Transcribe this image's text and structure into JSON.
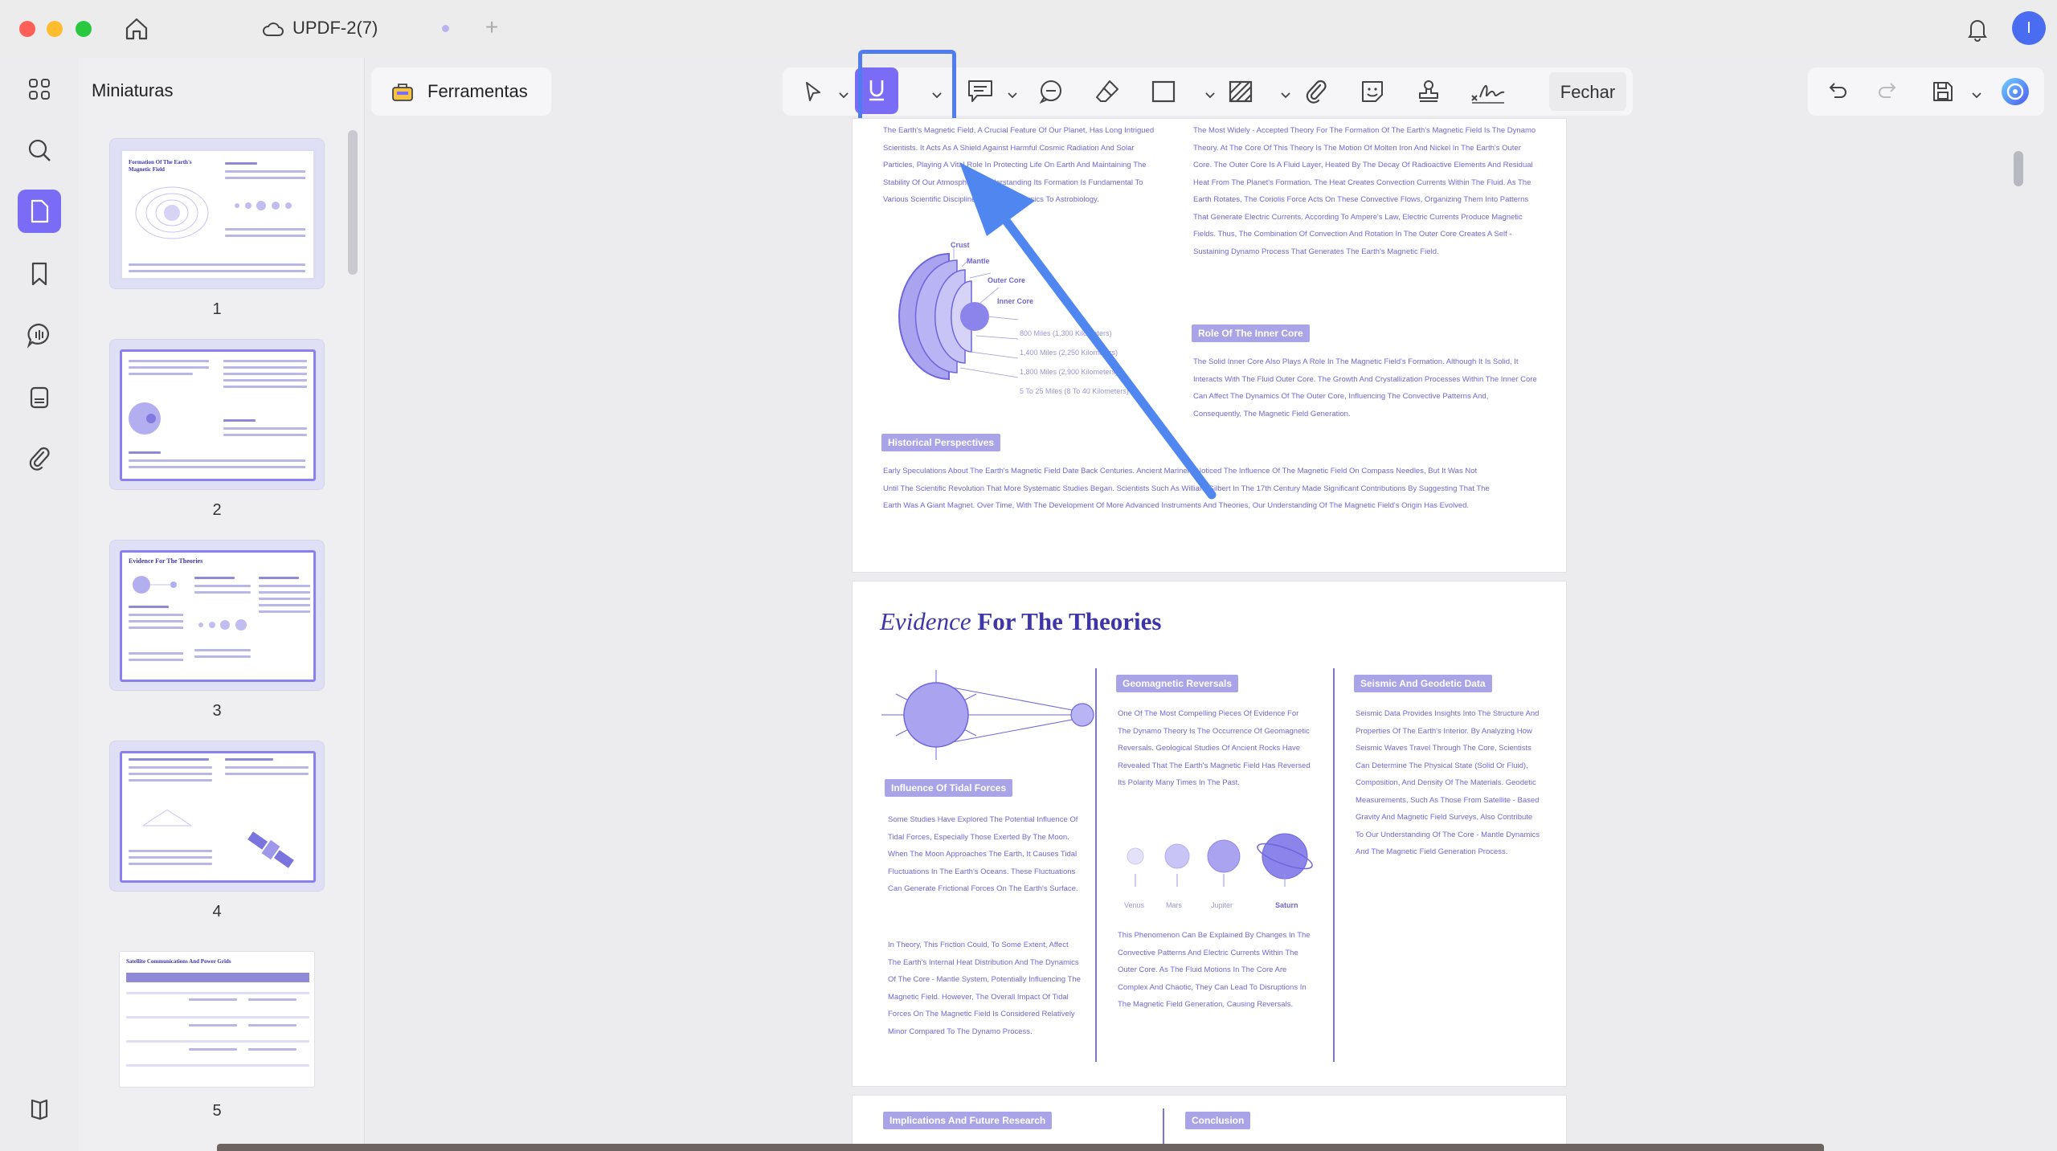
{
  "window": {
    "tab_title": "UPDF-2(7)",
    "avatar_initial": "I"
  },
  "sidebar": {
    "title": "Miniaturas",
    "pages": [
      "1",
      "2",
      "3",
      "4",
      "5"
    ],
    "thumb_titles": {
      "p1": "Formation Of The Earth's Magnetic Field",
      "p3": "Evidence For The Theories",
      "p5": "Satellite Communications And Power Grids"
    }
  },
  "toolbar": {
    "tools_label": "Ferramentas",
    "close_label": "Fechar"
  },
  "page2": {
    "intro": "The Earth's Magnetic Field, A Crucial Feature Of Our Planet, Has Long Intrigued Scientists. It Acts As A Shield Against Harmful Cosmic Radiation And Solar Particles, Playing A Vital Role In Protecting Life On Earth And Maintaining The Stability Of Our Atmosphere. Understanding Its Formation Is Fundamental To Various Scientific Disciplines, From Geophysics To Astrobiology.",
    "diagram_labels": {
      "crust": "Crust",
      "mantle": "Mantle",
      "outer_core": "Outer Core",
      "inner_core": "Inner Core",
      "d1": "800 Miles (1,300 Kilometers)",
      "d2": "1,400 Miles (2,250 Kilometers)",
      "d3": "1,800 Miles (2,900 Kilometers)",
      "d4": "5 To 25 Miles (8 To 40 Kilometers)"
    },
    "dynamo_text": "The Most Widely - Accepted Theory For The Formation Of The Earth's Magnetic Field Is The Dynamo Theory. At The Core Of This Theory Is The Motion Of Molten Iron And Nickel In The Earth's Outer Core. The Outer Core Is A Fluid Layer, Heated By The Decay Of Radioactive Elements And Residual Heat From The Planet's Formation. The Heat Creates Convection Currents Within The Fluid. As The Earth Rotates, The Coriolis Force Acts On These Convective Flows, Organizing Them Into Patterns That Generate Electric Currents. According To Ampere's Law, Electric Currents Produce Magnetic Fields. Thus, The Combination Of Convection And Rotation In The Outer Core Creates A Self - Sustaining Dynamo Process That Generates The Earth's Magnetic Field.",
    "inner_core_heading": "Role Of The Inner Core",
    "inner_core_text": "The Solid Inner Core Also Plays A Role In The Magnetic Field's Formation. Although It Is Solid, It Interacts With The Fluid Outer Core. The Growth And Crystallization Processes Within The Inner Core Can Affect The Dynamics Of The Outer Core, Influencing The Convective Patterns And, Consequently, The Magnetic Field Generation.",
    "historical_heading": "Historical Perspectives",
    "historical_text": "Early Speculations About The Earth's Magnetic Field Date Back Centuries. Ancient Mariners Noticed The Influence Of The Magnetic Field On Compass Needles, But It Was Not Until The Scientific Revolution That More Systematic Studies Began. Scientists Such As William Gilbert In The 17th Century Made Significant Contributions By Suggesting That The Earth Was A Giant Magnet. Over Time, With The Development Of More Advanced Instruments And Theories, Our Understanding Of The Magnetic Field's Origin Has Evolved."
  },
  "page3": {
    "title_italic": "Evidence",
    "title_rest": " For The Theories",
    "tidal_heading": "Influence Of Tidal Forces",
    "tidal_text_1": "Some Studies Have Explored The Potential Influence Of Tidal Forces, Especially Those Exerted By The Moon. When The Moon Approaches The Earth, It Causes Tidal Fluctuations In The Earth's Oceans. These Fluctuations Can Generate Frictional Forces On The Earth's Surface.",
    "tidal_text_2": "In Theory, This Friction Could, To Some Extent, Affect The Earth's Internal Heat Distribution And The Dynamics Of The Core - Mantle System, Potentially Influencing The Magnetic Field. However, The Overall Impact Of Tidal Forces On The Magnetic Field Is Considered Relatively Minor Compared To The Dynamo Process.",
    "geo_heading": "Geomagnetic Reversals",
    "geo_text": "One Of The Most Compelling Pieces Of Evidence For The Dynamo Theory Is The Occurrence Of Geomagnetic Reversals. Geological Studies Of Ancient Rocks Have Revealed That The Earth's Magnetic Field Has Reversed Its Polarity Many Times In The Past.",
    "planets": [
      "Venus",
      "Mars",
      "Jupiter",
      "Saturn"
    ],
    "phenomenon_text": "This Phenomenon Can Be Explained By Changes In The Convective Patterns And Electric Currents Within The Outer Core. As The Fluid Motions In The Core Are Complex And Chaotic, They Can Lead To Disruptions In The Magnetic Field Generation, Causing Reversals.",
    "seismic_heading": "Seismic And Geodetic Data",
    "seismic_text": "Seismic Data Provides Insights Into The Structure And Properties Of The Earth's Interior. By Analyzing How Seismic Waves Travel Through The Core, Scientists Can Determine The Physical State (Solid Or Fluid), Composition, And Density Of The Materials. Geodetic Measurements, Such As Those From Satellite - Based Gravity And Magnetic Field Surveys, Also Contribute To Our Understanding Of The Core - Mantle Dynamics And The Magnetic Field Generation Process."
  },
  "page4": {
    "heading_left": "Implications And Future Research",
    "heading_right": "Conclusion"
  },
  "colors": {
    "accent": "#7b6cf6",
    "doc_text": "#6f68d6",
    "highlight_box": "#4f7cf0",
    "arrow": "#4f86f0"
  },
  "icons": {
    "rail": [
      "apps-icon",
      "search-icon",
      "pages-icon",
      "bookmark-icon",
      "comment-icon",
      "form-icon",
      "attachment-icon",
      "layers-icon"
    ],
    "toolbar": [
      "select-arrow-icon",
      "underline-icon",
      "textbox-icon",
      "note-icon",
      "eraser-icon",
      "rectangle-icon",
      "area-icon",
      "paperclip-icon",
      "sticker-icon",
      "stamp-icon",
      "signature-icon"
    ]
  }
}
